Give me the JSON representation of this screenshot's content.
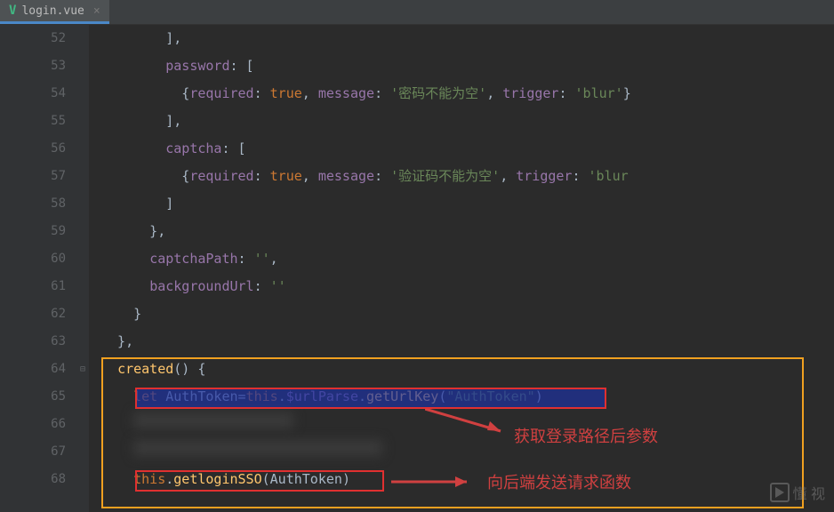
{
  "tab": {
    "filename": "login.vue"
  },
  "gutter": {
    "start": 52,
    "end": 68
  },
  "code": {
    "l52": "        ],",
    "l53_prop": "password",
    "l54": {
      "required": "required",
      "true": "true",
      "message": "message",
      "msgval": "'密码不能为空'",
      "trigger": "trigger",
      "blur": "'blur'"
    },
    "l55": "        ],",
    "l56_prop": "captcha",
    "l57": {
      "required": "required",
      "true": "true",
      "message": "message",
      "msgval": "'验证码不能为空'",
      "trigger": "trigger",
      "blur": "'blur"
    },
    "l58": "        ]",
    "l59": "      },",
    "l60_prop": "captchaPath",
    "l60_val": "''",
    "l61_prop": "backgroundUrl",
    "l61_val": "''",
    "l62": "    }",
    "l63": "  },",
    "l64_method": "created",
    "l65": {
      "let": "let",
      "authtoken": "AuthToken",
      "this": "this",
      "urlparse": "$urlParse",
      "getUrlKey": "getUrlKey",
      "arg": "\"AuthToken\""
    },
    "l68": {
      "this": "this",
      "method": "getloginSSO",
      "arg": "AuthToken"
    }
  },
  "annotations": {
    "a1": "获取登录路径后参数",
    "a2": "向后端发送请求函数"
  },
  "watermark": {
    "text": "懂 视"
  }
}
